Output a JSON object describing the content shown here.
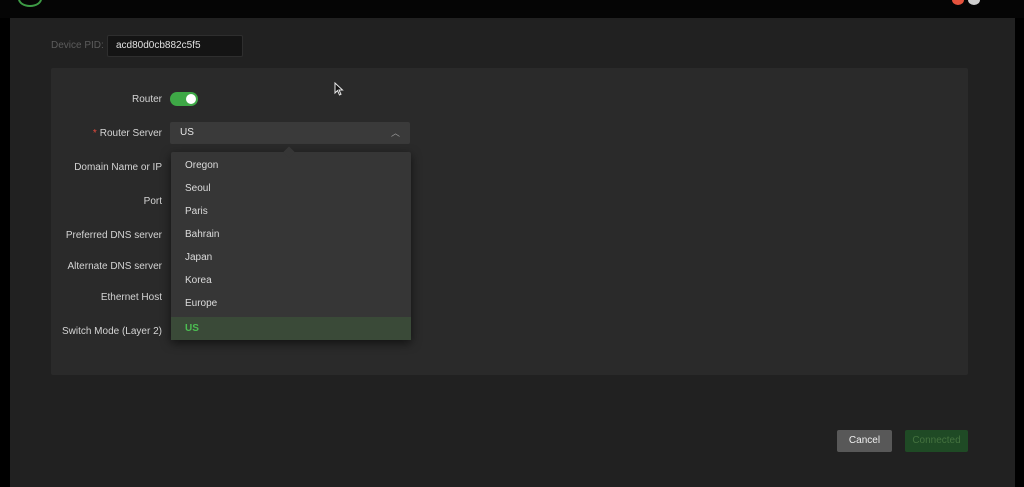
{
  "device": {
    "pid_label": "Device PID:",
    "pid_value": "acd80d0cb882c5f5"
  },
  "form": {
    "fields": [
      {
        "label": "Router",
        "required": false
      },
      {
        "label": "Router Server",
        "required": true
      },
      {
        "label": "Domain Name or IP",
        "required": false
      },
      {
        "label": "Port",
        "required": false
      },
      {
        "label": "Preferred DNS server",
        "required": false
      },
      {
        "label": "Alternate DNS server",
        "required": false
      },
      {
        "label": "Ethernet Host",
        "required": false
      },
      {
        "label": "Switch Mode (Layer 2)",
        "required": false
      }
    ],
    "router_enabled": true,
    "router_server": {
      "selected": "US",
      "options": [
        "Oregon",
        "Seoul",
        "Paris",
        "Bahrain",
        "Japan",
        "Korea",
        "Europe",
        "US"
      ]
    }
  },
  "buttons": {
    "cancel": "Cancel",
    "connected": "Connected"
  },
  "colors": {
    "accent": "#3ea846",
    "required": "#e64a3c"
  },
  "icons": {
    "dropdown": "chevron-up-icon",
    "cursor": "mouse-pointer-icon",
    "logo": "app-logo-icon"
  }
}
